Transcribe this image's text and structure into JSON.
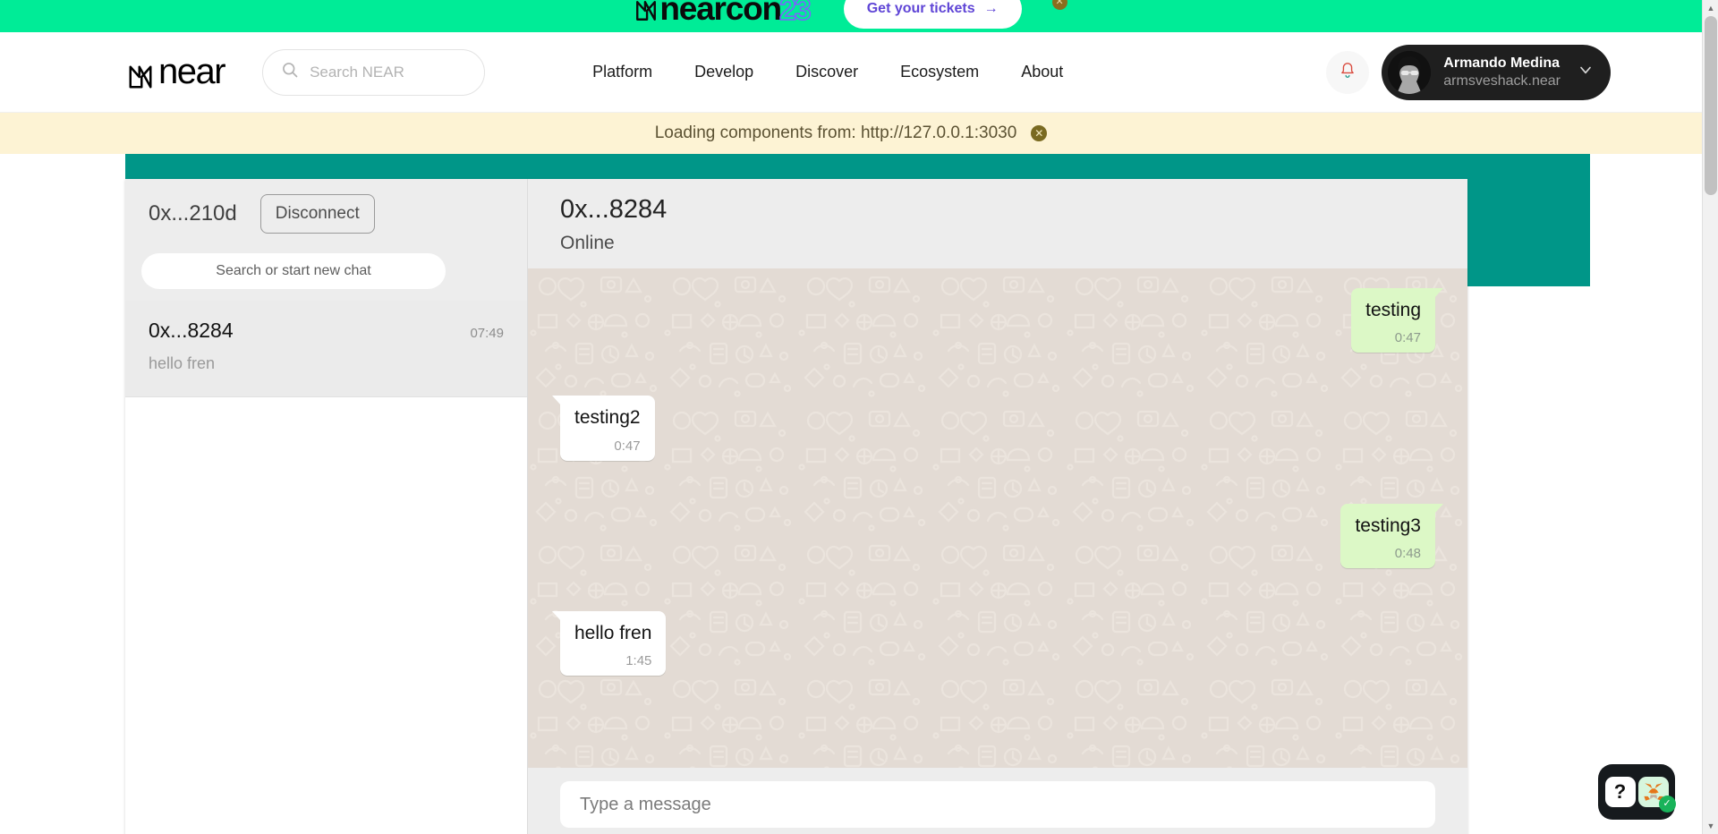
{
  "promo": {
    "logo_text": "nearcon",
    "logo_year": "23",
    "cta_label": "Get your tickets",
    "cta_arrow": "→",
    "close_icon": "close-icon",
    "bg_color": "#00ec97",
    "cta_text_color": "#5f45d6"
  },
  "nav": {
    "brand": "near",
    "search_placeholder": "Search NEAR",
    "search_value": "",
    "links": [
      {
        "label": "Platform"
      },
      {
        "label": "Develop"
      },
      {
        "label": "Discover"
      },
      {
        "label": "Ecosystem"
      },
      {
        "label": "About"
      }
    ],
    "bell_icon": "bell-icon",
    "profile": {
      "name": "Armando Medina",
      "handle": "armsveshack.near",
      "chevron_icon": "chevron-down-icon"
    }
  },
  "notice": {
    "text": "Loading components from: http://127.0.0.1:3030",
    "close_icon": "close-icon",
    "bg_color": "#fdf3d4"
  },
  "chat": {
    "accent_color": "#009688",
    "sidebar": {
      "wallet_address": "0x...210d",
      "disconnect_label": "Disconnect",
      "search_placeholder": "Search or start new chat",
      "search_value": "",
      "conversations": [
        {
          "name": "0x...8284",
          "time": "07:49",
          "preview": "hello fren"
        }
      ]
    },
    "conversation": {
      "title": "0x...8284",
      "status": "Online",
      "messages": [
        {
          "text": "testing",
          "time": "0:47",
          "direction": "out"
        },
        {
          "text": "testing2",
          "time": "0:47",
          "direction": "in"
        },
        {
          "text": "testing3",
          "time": "0:48",
          "direction": "out"
        },
        {
          "text": "hello fren",
          "time": "1:45",
          "direction": "in"
        }
      ],
      "composer_placeholder": "Type a message",
      "composer_value": "",
      "bubble_out_color": "#dcf8c6",
      "bubble_in_color": "#ffffff",
      "wallpaper_color": "#e3dbd4"
    }
  },
  "wallet_widget": {
    "help_label": "?",
    "fox_icon": "metamask-fox-icon",
    "status_icon": "check-icon",
    "status_color": "#19b35a"
  },
  "scrollbar": {
    "up_icon": "triangle-up-icon",
    "down_icon": "triangle-down-icon"
  }
}
